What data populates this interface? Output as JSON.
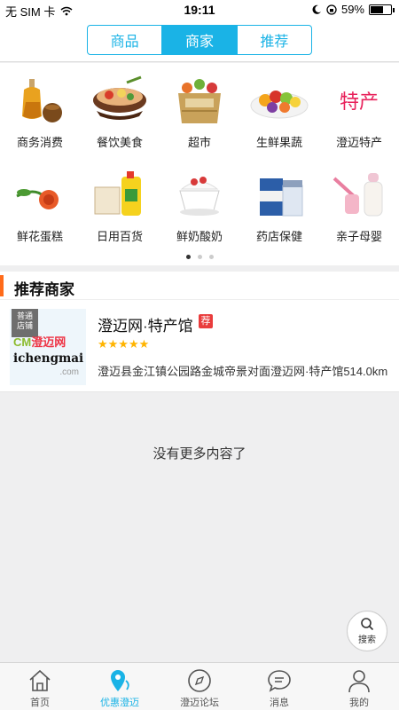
{
  "status_bar": {
    "carrier": "无 SIM 卡",
    "time": "19:11",
    "battery": "59%",
    "battery_level": 0.59
  },
  "header": {
    "tabs": [
      {
        "label": "商品"
      },
      {
        "label": "商家",
        "active": true
      },
      {
        "label": "推荐"
      }
    ]
  },
  "categories": [
    {
      "label": "商务消费",
      "icon": "liquor-icon"
    },
    {
      "label": "餐饮美食",
      "icon": "food-bowl-icon"
    },
    {
      "label": "超市",
      "icon": "grocery-basket-icon"
    },
    {
      "label": "生鲜果蔬",
      "icon": "fruit-platter-icon"
    },
    {
      "label": "澄迈特产",
      "icon": "specialty-text-icon"
    },
    {
      "label": "鲜花蛋糕",
      "icon": "flower-icon"
    },
    {
      "label": "日用百货",
      "icon": "household-goods-icon"
    },
    {
      "label": "鲜奶酸奶",
      "icon": "yogurt-icon"
    },
    {
      "label": "药店保健",
      "icon": "medicine-icon"
    },
    {
      "label": "亲子母婴",
      "icon": "baby-bottle-icon"
    }
  ],
  "specialty_icon_text": "特产",
  "pager": {
    "pages": 3,
    "current": 1
  },
  "section": {
    "title": "推荐商家"
  },
  "shop": {
    "tag_line1": "普通",
    "tag_line2": "店铺",
    "logo_cm": "CM",
    "logo_cn": "澄迈网",
    "logo_domain": "ichengmai",
    "logo_com": ".com",
    "name": "澄迈网·特产馆",
    "badge": "荐",
    "rating": 5,
    "stars": "★★★★★",
    "address": "澄迈县金江镇公园路金城帝景对面澄迈网·特产馆514.0km"
  },
  "footer_text": "没有更多内容了",
  "search_fab": {
    "label": "搜索"
  },
  "tabbar": [
    {
      "label": "首页",
      "icon": "home-icon"
    },
    {
      "label": "优惠澄迈",
      "icon": "location-pin-icon",
      "active": true
    },
    {
      "label": "澄迈论坛",
      "icon": "compass-icon"
    },
    {
      "label": "消息",
      "icon": "chat-bubble-icon"
    },
    {
      "label": "我的",
      "icon": "user-icon"
    }
  ],
  "colors": {
    "accent": "#1ab3e6",
    "section_bar": "#ff6b1a",
    "badge": "#e93c3c",
    "stars": "#ffb400"
  }
}
